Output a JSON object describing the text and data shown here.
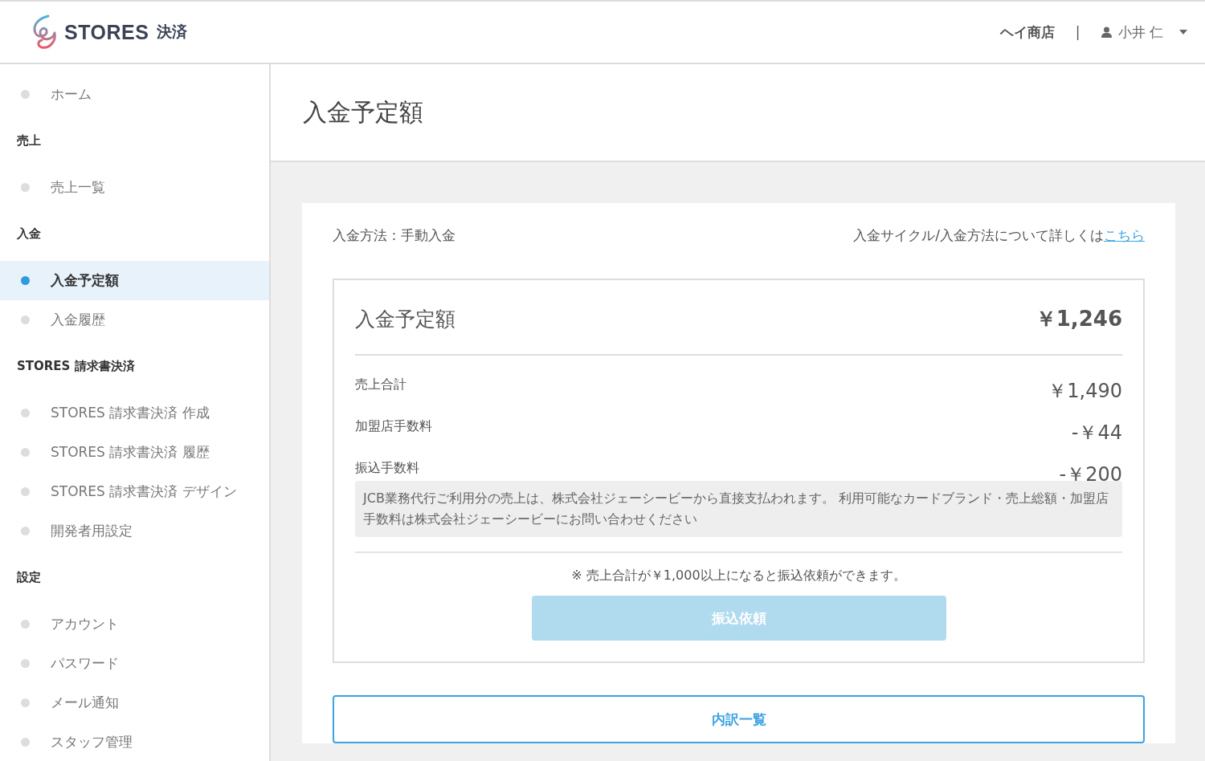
{
  "header": {
    "logo_text": "STORES",
    "logo_suffix": "決済",
    "shop_name": "ヘイ商店",
    "separator": "|",
    "user_name": "小井 仁"
  },
  "sidebar": {
    "items": [
      {
        "kind": "link",
        "label": "ホーム",
        "selected": false
      },
      {
        "kind": "heading",
        "label": "売上"
      },
      {
        "kind": "link",
        "label": "売上一覧",
        "selected": false
      },
      {
        "kind": "heading",
        "label": "入金"
      },
      {
        "kind": "link",
        "label": "入金予定額",
        "selected": true
      },
      {
        "kind": "link",
        "label": "入金履歴",
        "selected": false
      },
      {
        "kind": "heading",
        "label": "STORES 請求書決済"
      },
      {
        "kind": "link",
        "label": "STORES 請求書決済 作成",
        "selected": false
      },
      {
        "kind": "link",
        "label": "STORES 請求書決済 履歴",
        "selected": false
      },
      {
        "kind": "link",
        "label": "STORES 請求書決済 デザイン",
        "selected": false
      },
      {
        "kind": "link",
        "label": "開発者用設定",
        "selected": false
      },
      {
        "kind": "heading",
        "label": "設定"
      },
      {
        "kind": "link",
        "label": "アカウント",
        "selected": false
      },
      {
        "kind": "link",
        "label": "パスワード",
        "selected": false
      },
      {
        "kind": "link",
        "label": "メール通知",
        "selected": false
      },
      {
        "kind": "link",
        "label": "スタッフ管理",
        "selected": false
      }
    ]
  },
  "page_title": "入金予定額",
  "card": {
    "method": "入金方法：手動入金",
    "info_text": "入金サイクル/入金方法について詳しくは",
    "info_link": "こちら",
    "summary": {
      "title": "入金予定額",
      "total": "￥1,246",
      "rows": [
        {
          "label": "売上合計",
          "value": "￥1,490"
        },
        {
          "label": "加盟店手数料",
          "value": "-￥44"
        },
        {
          "label": "振込手数料",
          "value": "-￥200"
        }
      ],
      "note": "JCB業務代行ご利用分の売上は、株式会社ジェーシービーから直接支払われます。 利用可能なカードブランド・売上総額・加盟店手数料は株式会社ジェーシービーにお問い合わせください",
      "notice": "※ 売上合計が￥1,000以上になると振込依頼ができます。",
      "button": {
        "label": "振込依頼",
        "disabled": true
      }
    },
    "breakdown_button": "内訳一覧"
  }
}
